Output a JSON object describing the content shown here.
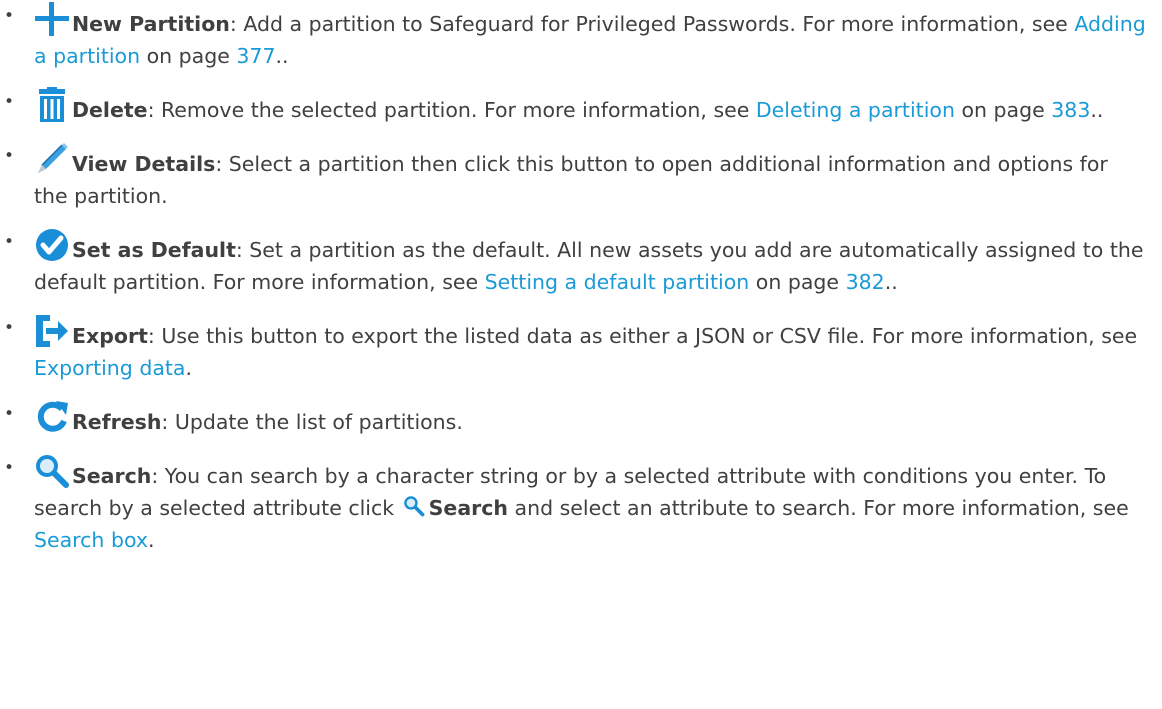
{
  "items": [
    {
      "icon": "plus-icon",
      "term": "New Partition",
      "text1": ": Add a partition to Safeguard for Privileged Passwords. For more information, see ",
      "link1": "Adding a partition",
      "text2": " on page ",
      "link2": "377",
      "text3": ".."
    },
    {
      "icon": "trash-icon",
      "term": "Delete",
      "text1": ": Remove the selected partition. For more information, see ",
      "link1": "Deleting a partition",
      "text2": " on page ",
      "link2": "383",
      "text3": ".."
    },
    {
      "icon": "pencil-icon",
      "term": "View Details",
      "text1": ": Select a partition then click this button to open additional information and options for the partition."
    },
    {
      "icon": "checkmark-circle-icon",
      "term": "Set as Default",
      "text1": ": Set a partition as the default. All new assets you add are automatically assigned to the default partition. For more information, see ",
      "link1": "Setting a default partition",
      "text2": " on page ",
      "link2": "382",
      "text3": ".."
    },
    {
      "icon": "export-icon",
      "term": "Export",
      "text1": ": Use this button to export the listed data as either a JSON or CSV file. For more information, see ",
      "link1": "Exporting data",
      "text3": "."
    },
    {
      "icon": "refresh-icon",
      "term": "Refresh",
      "text1": ": Update the list of partitions."
    },
    {
      "icon": "search-icon",
      "term": "Search",
      "text1": ": You can search by a character string or by a selected attribute with conditions you enter. To search by a selected attribute click ",
      "inline_term": "Search",
      "text2": " and select an attribute to search. For more information, see ",
      "link1": "Search box",
      "text3": "."
    }
  ],
  "colors": {
    "text": "#404040",
    "link": "#1a9ad6",
    "icon_blue": "#1a8fd8"
  }
}
